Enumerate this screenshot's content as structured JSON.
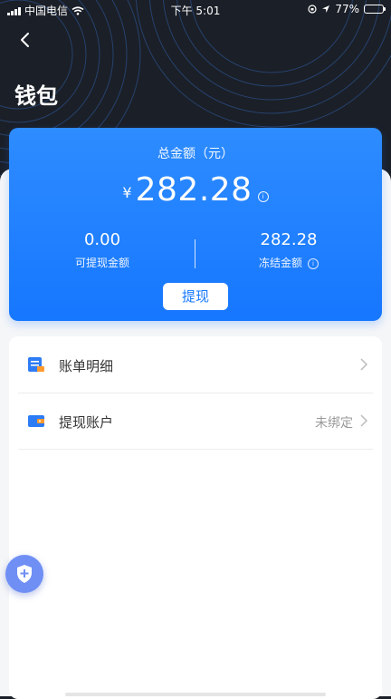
{
  "status_bar": {
    "carrier": "中国电信",
    "time": "下午 5:01",
    "battery_percent": "77%",
    "battery_level": 0.77
  },
  "header": {
    "title": "钱包"
  },
  "wallet": {
    "title": "总金额（元）",
    "currency_symbol": "¥",
    "total": "282.28",
    "withdrawable_amount": "0.00",
    "withdrawable_label": "可提现金额",
    "frozen_amount": "282.28",
    "frozen_label": "冻结金额",
    "withdraw_button": "提现",
    "colors": {
      "card": "#1677ff",
      "button_text": "#1677ff"
    }
  },
  "menu": {
    "items": [
      {
        "label": "账单明细",
        "value": "",
        "icon": "bill-icon"
      },
      {
        "label": "提现账户",
        "value": "未绑定",
        "icon": "wallet-icon"
      }
    ]
  }
}
